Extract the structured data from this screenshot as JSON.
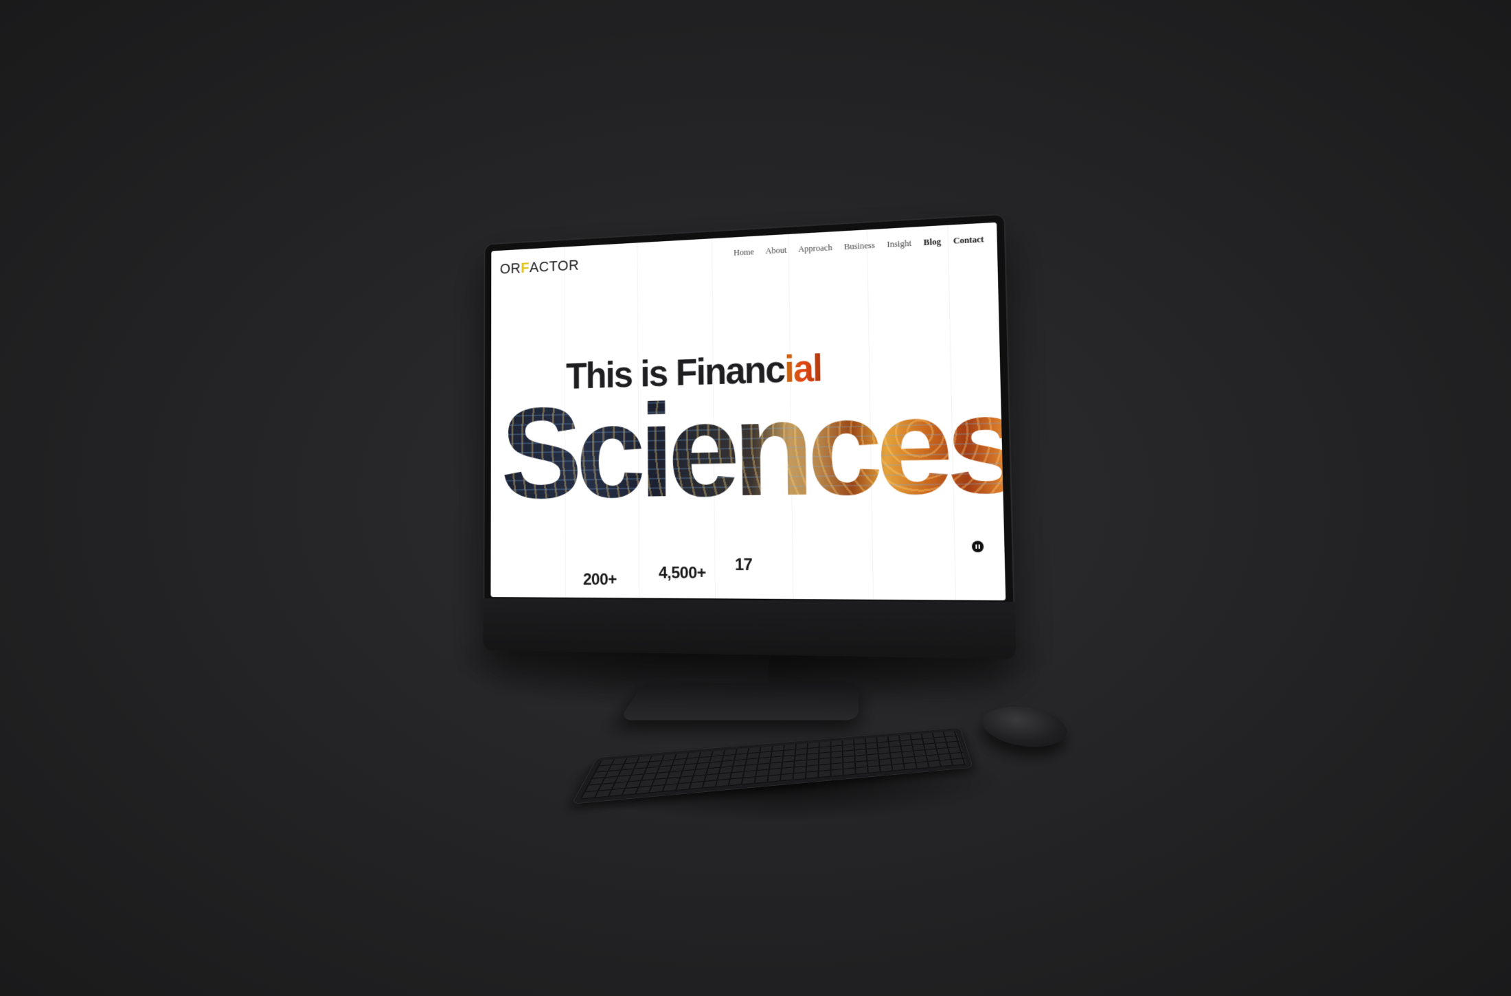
{
  "site": {
    "logo_prefix": "OR",
    "logo_mark": "F",
    "logo_suffix": "ACTOR"
  },
  "nav": {
    "items": [
      {
        "label": "Home"
      },
      {
        "label": "About"
      },
      {
        "label": "Approach"
      },
      {
        "label": "Business"
      },
      {
        "label": "Insight"
      },
      {
        "label": "Blog"
      },
      {
        "label": "Contact"
      }
    ]
  },
  "hero": {
    "eyebrow_main": "This is Financ",
    "eyebrow_tail": "ial",
    "headline": "Sciences."
  },
  "stats": [
    {
      "value": "200+"
    },
    {
      "value": "4,500+"
    },
    {
      "value": "17"
    }
  ],
  "controls": {
    "pause_icon": "pause-icon"
  },
  "colors": {
    "background": "#262628",
    "screen": "#ffffff",
    "logo_accent": "#e3c21b",
    "text_dark": "#1f1f22"
  }
}
